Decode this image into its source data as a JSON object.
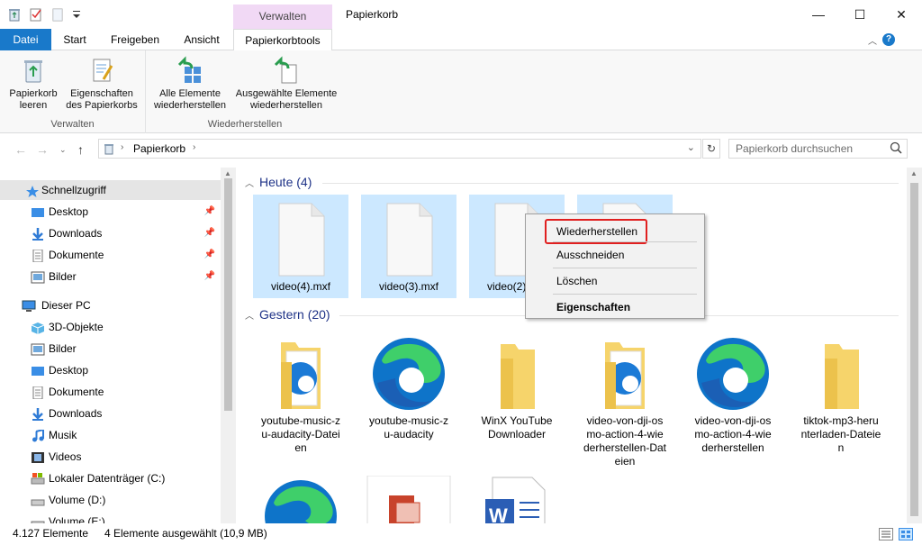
{
  "window": {
    "title": "Papierkorb",
    "context_tab_label": "Verwalten",
    "minimize": "—",
    "maximize": "☐",
    "close": "✕"
  },
  "tabs": {
    "file": "Datei",
    "start": "Start",
    "share": "Freigeben",
    "view": "Ansicht",
    "tools": "Papierkorbtools",
    "help": "?"
  },
  "ribbon": {
    "group_manage": "Verwalten",
    "group_restore": "Wiederherstellen",
    "empty_line1": "Papierkorb",
    "empty_line2": "leeren",
    "props_line1": "Eigenschaften",
    "props_line2": "des Papierkorbs",
    "restore_all_line1": "Alle Elemente",
    "restore_all_line2": "wiederherstellen",
    "restore_sel_line1": "Ausgewählte Elemente",
    "restore_sel_line2": "wiederherstellen"
  },
  "address": {
    "path": "Papierkorb",
    "search_placeholder": "Papierkorb durchsuchen"
  },
  "sidebar": {
    "quick_access": "Schnellzugriff",
    "quick": [
      "Desktop",
      "Downloads",
      "Dokumente",
      "Bilder"
    ],
    "this_pc": "Dieser PC",
    "pc": [
      "3D-Objekte",
      "Bilder",
      "Desktop",
      "Dokumente",
      "Downloads",
      "Musik",
      "Videos",
      "Lokaler Datenträger (C:)",
      "Volume (D:)",
      "Volume (E:)"
    ]
  },
  "content": {
    "group_today": "Heute (4)",
    "group_yesterday": "Gestern (20)",
    "today_files": [
      "video(4).mxf",
      "video(3).mxf",
      "video(2).mxf",
      ""
    ],
    "yesterday_items": [
      {
        "line1": "youtube-music-z",
        "line2": "u-audacity-Datei",
        "line3": "en",
        "line4": ""
      },
      {
        "line1": "youtube-music-z",
        "line2": "u-audacity",
        "line3": "",
        "line4": ""
      },
      {
        "line1": "WinX YouTube",
        "line2": "Downloader",
        "line3": "",
        "line4": ""
      },
      {
        "line1": "video-von-dji-os",
        "line2": "mo-action-4-wie",
        "line3": "derherstellen-Dat",
        "line4": "eien"
      },
      {
        "line1": "video-von-dji-os",
        "line2": "mo-action-4-wie",
        "line3": "derherstellen",
        "line4": ""
      },
      {
        "line1": "tiktok-mp3-heru",
        "line2": "nterladen-Dateie",
        "line3": "n",
        "line4": ""
      }
    ]
  },
  "context_menu": {
    "restore": "Wiederherstellen",
    "cut": "Ausschneiden",
    "delete": "Löschen",
    "properties": "Eigenschaften"
  },
  "status": {
    "count": "4.127 Elemente",
    "selected": "4 Elemente ausgewählt (10,9 MB)"
  },
  "colors": {
    "accent": "#1979ca",
    "selection": "#cce8ff",
    "manage_tab": "#f1d9f5",
    "group_header": "#1e3287",
    "highlight_box": "#e02020"
  }
}
